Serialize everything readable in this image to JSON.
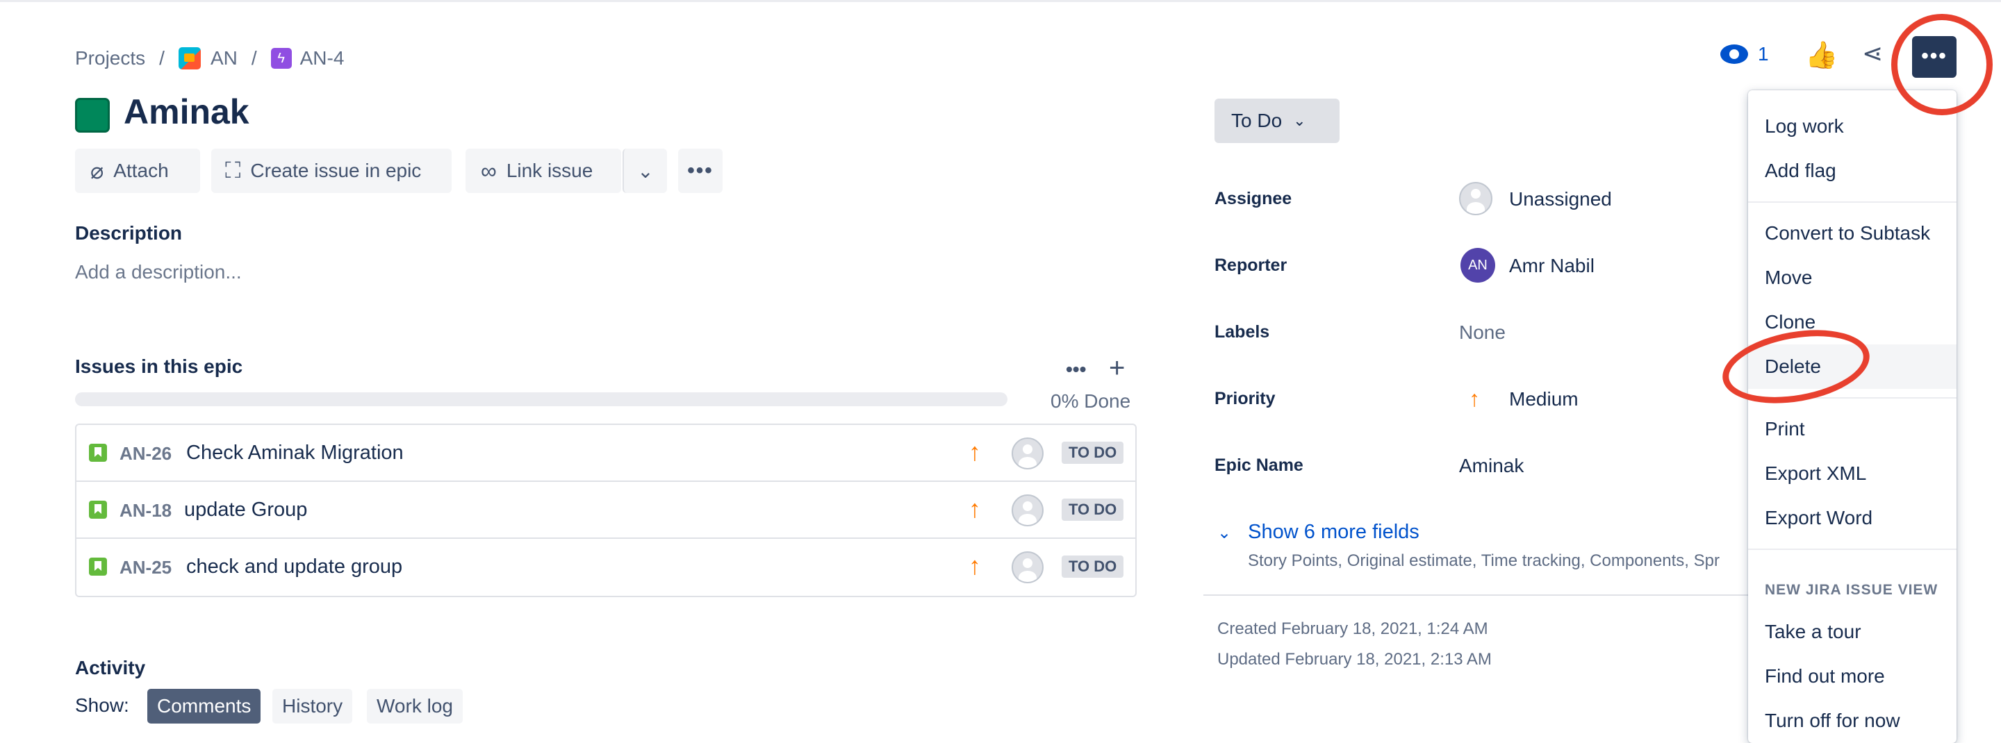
{
  "breadcrumb": {
    "projects": "Projects",
    "sep1": "/",
    "project": "AN",
    "sep2": "/",
    "issue_key": "AN-4",
    "epic_glyph": "ϟ"
  },
  "issue": {
    "title": "Aminak"
  },
  "actions": {
    "attach": "Attach",
    "create_in_epic": "Create issue in epic",
    "link_issue": "Link issue",
    "more": "•••"
  },
  "description": {
    "heading": "Description",
    "placeholder": "Add a description..."
  },
  "epic_issues": {
    "heading": "Issues in this epic",
    "dots": "•••",
    "plus": "+",
    "progress_percent": 0,
    "progress_label": "0% Done",
    "rows": [
      {
        "key": "AN-26",
        "summary": "Check Aminak Migration",
        "priority_glyph": "↑",
        "status": "TO DO"
      },
      {
        "key": "AN-18",
        "summary": "update Group",
        "priority_glyph": "↑",
        "status": "TO DO"
      },
      {
        "key": "AN-25",
        "summary": "check and update group",
        "priority_glyph": "↑",
        "status": "TO DO"
      }
    ]
  },
  "activity": {
    "heading": "Activity",
    "show_label": "Show:",
    "tabs": [
      "Comments",
      "History",
      "Work log"
    ]
  },
  "status_button": {
    "label": "To Do",
    "chevron": "⌄"
  },
  "fields": {
    "assignee_label": "Assignee",
    "assignee_value": "Unassigned",
    "reporter_label": "Reporter",
    "reporter_initials": "AN",
    "reporter_value": "Amr Nabil",
    "labels_label": "Labels",
    "labels_value": "None",
    "priority_label": "Priority",
    "priority_glyph": "↑",
    "priority_value": "Medium",
    "epic_name_label": "Epic Name",
    "epic_name_value": "Aminak",
    "show_more_chevron": "⌄",
    "show_more": "Show 6 more fields",
    "show_more_sub": "Story Points, Original estimate, Time tracking, Components, Spr"
  },
  "dates": {
    "created": "Created February 18, 2021, 1:24 AM",
    "updated": "Updated February 18, 2021, 2:13 AM"
  },
  "top_actions": {
    "watch_count": "1",
    "thumb_glyph": "👍",
    "share_glyph": "⋖",
    "more_glyph": "•••"
  },
  "menu": {
    "items_1": [
      "Log work",
      "Add flag"
    ],
    "items_2": [
      "Convert to Subtask",
      "Move",
      "Clone",
      "Delete"
    ],
    "items_3": [
      "Print",
      "Export XML",
      "Export Word"
    ],
    "group_heading": "NEW JIRA ISSUE VIEW",
    "items_4": [
      "Take a tour",
      "Find out more",
      "Turn off for now"
    ],
    "hovered_item": "Delete"
  },
  "annotation_color": "#e8402e",
  "colors": {
    "primary_link": "#0052cc",
    "epic": "#904ee2",
    "story": "#63ba3c",
    "priority_medium": "#ff7a00"
  }
}
